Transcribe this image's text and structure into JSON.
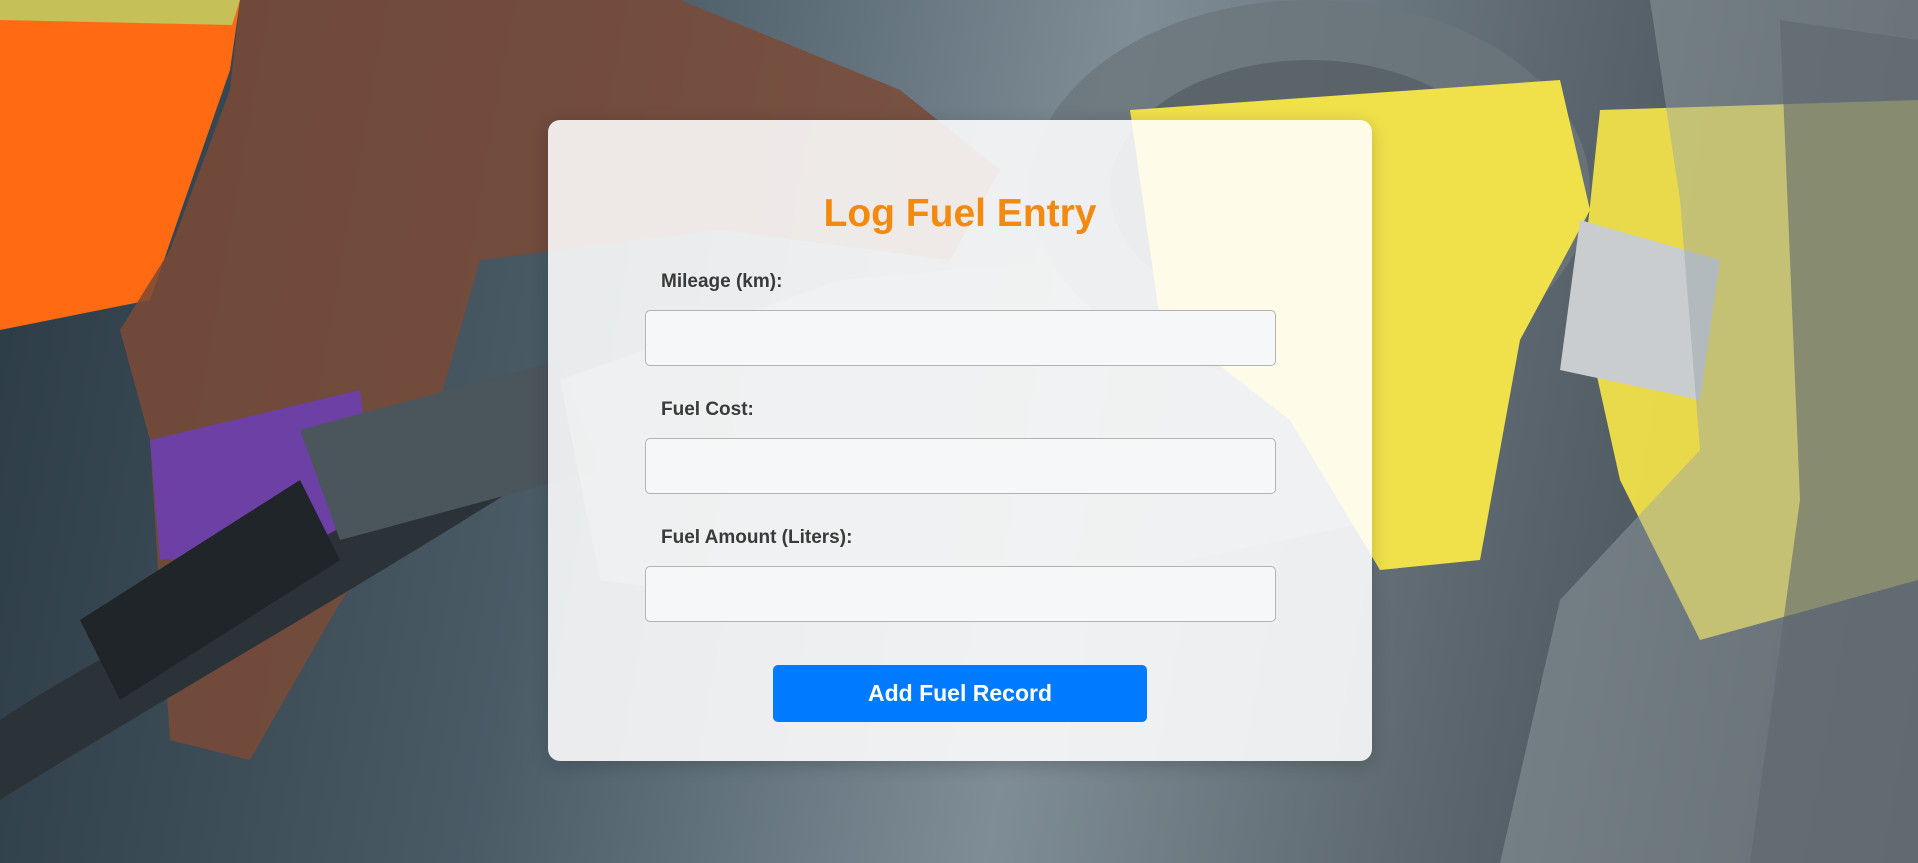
{
  "form": {
    "title": "Log Fuel Entry",
    "fields": [
      {
        "label": "Mileage (km):",
        "value": "",
        "placeholder": ""
      },
      {
        "label": "Fuel Cost:",
        "value": "",
        "placeholder": ""
      },
      {
        "label": "Fuel Amount (Liters):",
        "value": "",
        "placeholder": ""
      }
    ],
    "submit_label": "Add Fuel Record"
  },
  "colors": {
    "title": "#f28a10",
    "button": "#007bff",
    "button_text": "#ffffff",
    "label": "#3a3a3a"
  },
  "background": {
    "image": "fuel-pump-photo"
  }
}
